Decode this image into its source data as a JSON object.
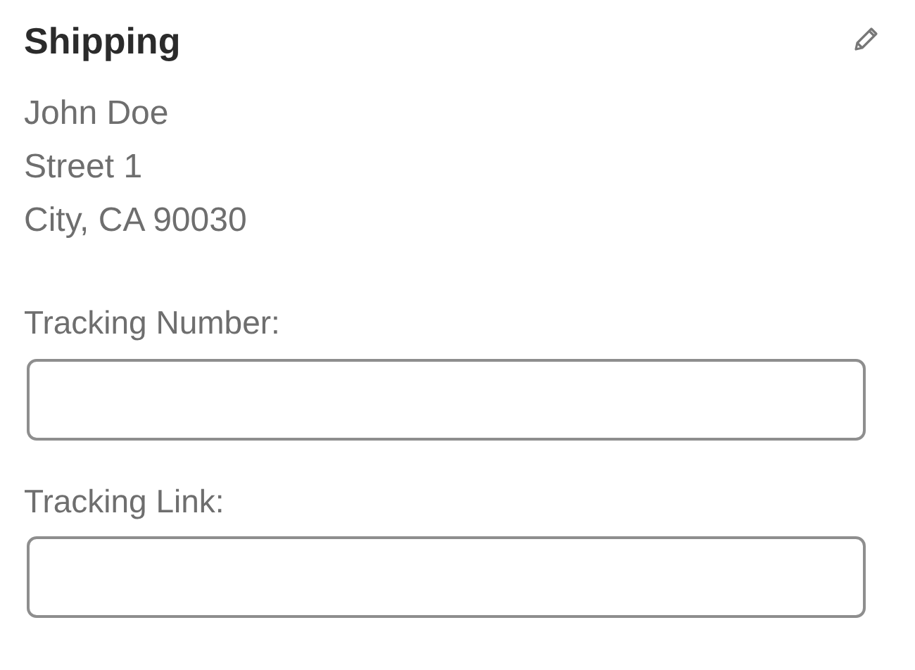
{
  "section": {
    "title": "Shipping",
    "edit_icon": true
  },
  "address": [
    "John Doe",
    "Street 1",
    "City, CA 90030"
  ],
  "fields": [
    {
      "label": "Tracking Number:"
    },
    {
      "label": "Tracking Link:"
    }
  ]
}
